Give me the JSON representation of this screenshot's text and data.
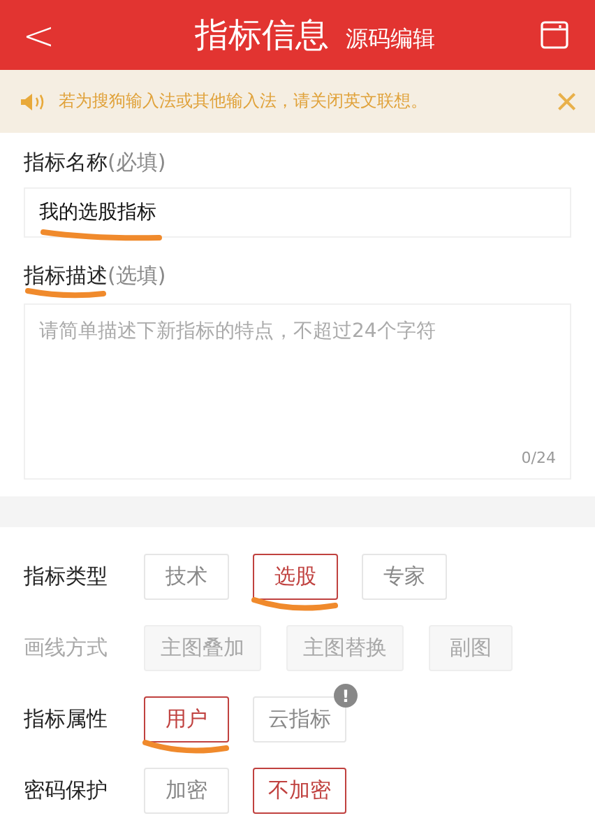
{
  "header": {
    "back": "<",
    "title": "指标信息",
    "subtitle": "源码编辑"
  },
  "notice": {
    "text": "若为搜狗输入法或其他输入法，请关闭英文联想。",
    "close": "×"
  },
  "name_field": {
    "label": "指标名称",
    "hint": "(必填)",
    "value": "我的选股指标",
    "underlined": true
  },
  "desc_field": {
    "label": "指标描述",
    "hint": "(选填)",
    "placeholder": "请简单描述下新指标的特点，不超过24个字符",
    "counter": "0/24",
    "underlined": true
  },
  "options": [
    {
      "label": "指标类型",
      "disabled": false,
      "choices": [
        {
          "text": "技术",
          "selected": false
        },
        {
          "text": "选股",
          "selected": true,
          "underlined": true
        },
        {
          "text": "专家",
          "selected": false
        }
      ]
    },
    {
      "label": "画线方式",
      "disabled": true,
      "choices": [
        {
          "text": "主图叠加",
          "selected": false
        },
        {
          "text": "主图替换",
          "selected": false
        },
        {
          "text": "副图",
          "selected": false
        }
      ]
    },
    {
      "label": "指标属性",
      "disabled": false,
      "choices": [
        {
          "text": "用户",
          "selected": true,
          "underlined": true
        },
        {
          "text": "云指标",
          "selected": false,
          "badge": "!"
        }
      ]
    },
    {
      "label": "密码保护",
      "disabled": false,
      "choices": [
        {
          "text": "加密",
          "selected": false
        },
        {
          "text": "不加密",
          "selected": true
        }
      ]
    }
  ]
}
